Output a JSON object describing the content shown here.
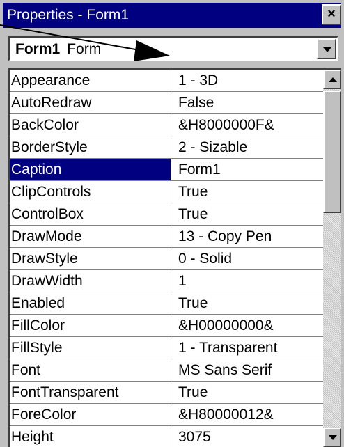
{
  "window": {
    "title": "Properties - Form1"
  },
  "object_selector": {
    "name": "Form1",
    "type": "Form"
  },
  "properties": [
    {
      "name": "Appearance",
      "value": "1 - 3D"
    },
    {
      "name": "AutoRedraw",
      "value": "False"
    },
    {
      "name": "BackColor",
      "value": "&H8000000F&"
    },
    {
      "name": "BorderStyle",
      "value": "2 - Sizable"
    },
    {
      "name": "Caption",
      "value": "Form1",
      "selected": true
    },
    {
      "name": "ClipControls",
      "value": "True"
    },
    {
      "name": "ControlBox",
      "value": "True"
    },
    {
      "name": "DrawMode",
      "value": "13 - Copy Pen"
    },
    {
      "name": "DrawStyle",
      "value": "0 - Solid"
    },
    {
      "name": "DrawWidth",
      "value": "1"
    },
    {
      "name": "Enabled",
      "value": "True"
    },
    {
      "name": "FillColor",
      "value": "&H00000000&"
    },
    {
      "name": "FillStyle",
      "value": "1 - Transparent"
    },
    {
      "name": "Font",
      "value": "MS Sans Serif"
    },
    {
      "name": "FontTransparent",
      "value": "True"
    },
    {
      "name": "ForeColor",
      "value": "&H80000012&"
    },
    {
      "name": "Height",
      "value": "3075"
    }
  ],
  "icons": {
    "close": "close-icon",
    "dropdown": "chevron-down-icon",
    "scroll_up": "scroll-up-arrow-icon",
    "scroll_down": "scroll-down-arrow-icon",
    "callout": "callout-arrow-icon"
  },
  "colors": {
    "titlebar": "#000080",
    "selection": "#000080",
    "face": "#c0c0c0"
  }
}
